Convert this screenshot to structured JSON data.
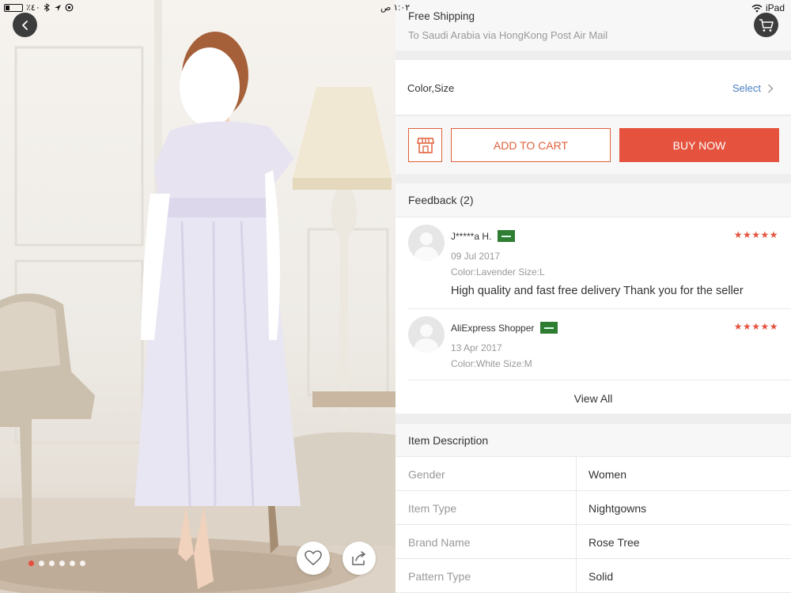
{
  "status_bar": {
    "left_text": "٪٤٠",
    "time": "١:٠٢ ص",
    "device": "iPad"
  },
  "gallery": {
    "image_count": 6,
    "active_index": 0,
    "accent_color": "#e84c3d"
  },
  "shipping": {
    "title": "Free Shipping",
    "subtitle": "To Saudi Arabia via HongKong Post Air Mail"
  },
  "variant": {
    "label": "Color,Size",
    "select_label": "Select"
  },
  "actions": {
    "add_to_cart": "ADD TO CART",
    "buy_now": "BUY NOW",
    "brand_color": "#e5533e"
  },
  "feedback": {
    "title": "Feedback (2)",
    "reviews": [
      {
        "name": "J*****a H.",
        "stars": "★★★★★",
        "rating": 5,
        "date": "09 Jul 2017",
        "sku": "Color:Lavender Size:L",
        "text": "High quality and fast free delivery Thank you for the seller"
      },
      {
        "name": "AliExpress Shopper",
        "stars": "★★★★★",
        "rating": 5,
        "date": "13 Apr 2017",
        "sku": "Color:White Size:M",
        "text": ""
      }
    ],
    "view_all": "View All"
  },
  "description": {
    "title": "Item Description",
    "rows": [
      {
        "key": "Gender",
        "value": "Women"
      },
      {
        "key": "Item Type",
        "value": "Nightgowns"
      },
      {
        "key": "Brand Name",
        "value": "Rose Tree"
      },
      {
        "key": "Pattern Type",
        "value": "Solid"
      }
    ]
  }
}
